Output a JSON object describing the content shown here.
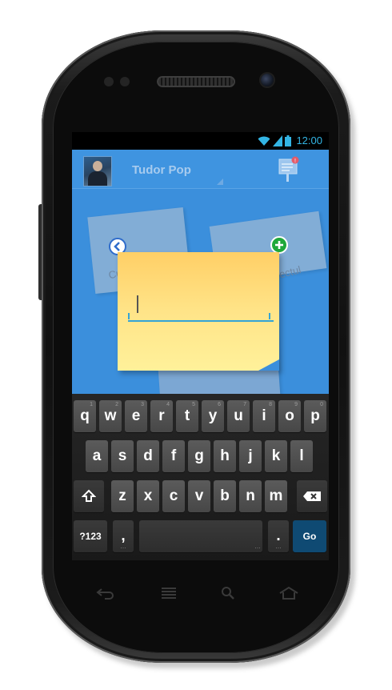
{
  "status_bar": {
    "time": "12:00",
    "icons": [
      "wifi-icon",
      "signal-icon",
      "battery-icon"
    ],
    "accent": "#33b5e5"
  },
  "header": {
    "user_name": "Tudor Pop",
    "avatar": "user-avatar",
    "notes_icon": "notes-notification-icon"
  },
  "notes": {
    "background_labels": [
      "Cumparaturi",
      "Proiectul"
    ],
    "back_button_icon": "chevron-left-icon",
    "add_button_icon": "plus-icon",
    "active_note": {
      "input_value": "",
      "color": "#ffe488"
    }
  },
  "keyboard": {
    "row1": [
      {
        "label": "q",
        "hint": "1"
      },
      {
        "label": "w",
        "hint": "2"
      },
      {
        "label": "e",
        "hint": "3"
      },
      {
        "label": "r",
        "hint": "4"
      },
      {
        "label": "t",
        "hint": "5"
      },
      {
        "label": "y",
        "hint": "6"
      },
      {
        "label": "u",
        "hint": "7"
      },
      {
        "label": "i",
        "hint": "8"
      },
      {
        "label": "o",
        "hint": "9"
      },
      {
        "label": "p",
        "hint": "0"
      }
    ],
    "row2": [
      "a",
      "s",
      "d",
      "f",
      "g",
      "h",
      "j",
      "k",
      "l"
    ],
    "row3": [
      "z",
      "x",
      "c",
      "v",
      "b",
      "n",
      "m"
    ],
    "symbols_label": "?123",
    "comma_label": ",",
    "period_label": ".",
    "go_label": "Go"
  },
  "colors": {
    "app_background": "#3b8fdc",
    "go_key": "#0f4a73",
    "add_button": "#1fa83a"
  }
}
